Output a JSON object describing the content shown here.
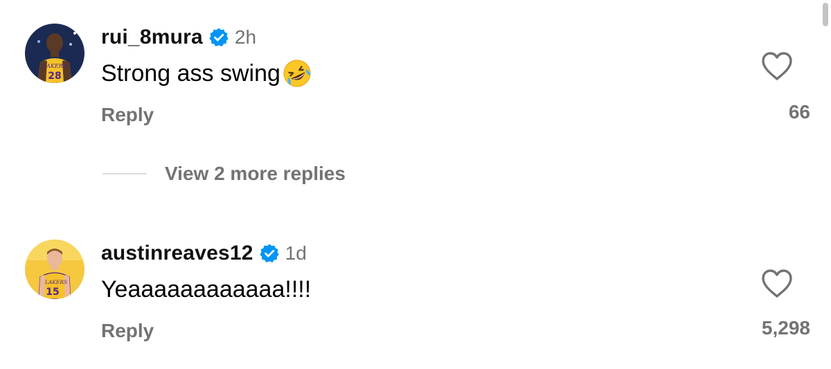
{
  "comments": [
    {
      "username": "rui_8mura",
      "verified": true,
      "time": "2h",
      "text": "Strong ass swing",
      "emoji": "rolling-on-floor-laughing-emoji",
      "reply_label": "Reply",
      "likes": "66",
      "avatar_jersey_number": "28",
      "avatar_jersey_text": "LAKERS"
    },
    {
      "username": "austinreaves12",
      "verified": true,
      "time": "1d",
      "text": "Yeaaaaaaaaaaaa!!!!",
      "reply_label": "Reply",
      "likes": "5,298",
      "avatar_jersey_number": "15",
      "avatar_jersey_text": "LAKERS"
    }
  ],
  "view_replies": {
    "label": "View 2 more replies"
  },
  "colors": {
    "verified_blue": "#0095f6",
    "secondary_text": "#737373",
    "lakers_gold": "#f6c12a",
    "lakers_purple": "#552583"
  },
  "icons": {
    "like": "heart-outline-icon",
    "verified": "verified-badge-icon"
  }
}
